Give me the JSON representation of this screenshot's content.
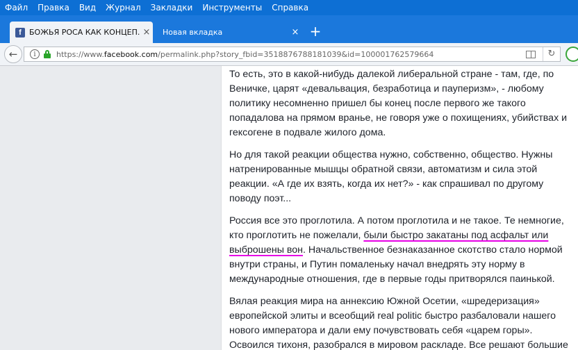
{
  "menu": [
    "Файл",
    "Правка",
    "Вид",
    "Журнал",
    "Закладки",
    "Инструменты",
    "Справка"
  ],
  "tabs": [
    {
      "title": "БОЖЬЯ РОСА КАК КОНЦЕП...",
      "close": "×"
    },
    {
      "title": "Новая вкладка",
      "close": "×"
    }
  ],
  "new_tab": "+",
  "url": {
    "prefix": "https://www.",
    "host": "facebook.com",
    "path": "/permalink.php?story_fbid=3518876788181039&id=100001762579664"
  },
  "icons": {
    "back": "back-arrow-icon",
    "info": "info-icon",
    "lock": "lock-icon",
    "reader": "reader-view-icon",
    "reload": "reload-icon",
    "favicon": "facebook-icon"
  },
  "colors": {
    "menubar": "#0d6fd4",
    "tabstrip": "#1b78dc",
    "underline": "#e600e6",
    "lock": "#2aa52a"
  },
  "post": {
    "p1": "То есть, это в какой-нибудь далекой либеральной стране - там, где, по Веничке, царят «девальвация, безработица и пауперизм», - любому политику несомненно пришел бы конец после первого же такого попадалова на прямом вранье, не говоря уже о похищениях, убийствах и гексогене в подвале жилого дома.",
    "p2": "Но для такой реакции общества нужно, собственно, общество. Нужны натренированные мышцы обратной связи, автоматизм и сила этой реакции. «А где их взять, когда их нет?» - как спрашивал по другому поводу поэт...",
    "p3_before": "Россия все это проглотила. А потом проглотила и не такое. Те немногие, кто проглотить не пожелали, ",
    "p3_highlight": "были быстро закатаны под асфальт или выброшены вон",
    "p3_after": ". Начальственное безнаказанное скотство стало нормой внутри страны, и Путин помаленьку начал внедрять эту норму в международные отношения, где в первые годы притворялся паинькой.",
    "p4": "Вялая реакция мира на аннексию Южной Осетии, «шредеризация» европейской элиты и всеобщий real politic быстро разбаловали нашего нового императора и дали ему почувствовать себя «царем горы». Освоился тихоня, разобрался в мировом раскладе. Все решают большие батальоны, а значит, стесняться некого. Умоются!"
  }
}
